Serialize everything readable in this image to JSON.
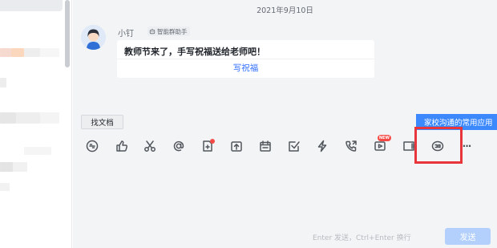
{
  "chat": {
    "date": "2021年9月10日",
    "sender_name": "小钉",
    "sender_badge": "智能群助手",
    "card": {
      "title": "教师节来了，手写祝福送给老师吧！",
      "link": "写祝福"
    }
  },
  "composer": {
    "find_doc_label": "找文档",
    "tooltip": "家校沟通的常用应用",
    "send_hint": "Enter 发送，Ctrl+Enter 换行",
    "send_label": "发送",
    "new_badge": "NEW",
    "more_label": "···"
  },
  "toolbar_icons": [
    "link-icon",
    "thumbs-up-icon",
    "scissors-icon",
    "at-icon",
    "file-plus-icon",
    "upload-icon",
    "schedule-icon",
    "checkbox-icon",
    "lightning-icon",
    "phone-icon",
    "video-play-icon",
    "live-icon",
    "edu-apps-icon",
    "more-icon"
  ],
  "colors": {
    "accent": "#3370ff",
    "tooltip_bg": "#3c89fd",
    "highlight": "#e8353b",
    "notify_red": "#f54a45",
    "send_disabled": "#b3d0fd",
    "chat_bg": "#f3f4f6"
  }
}
